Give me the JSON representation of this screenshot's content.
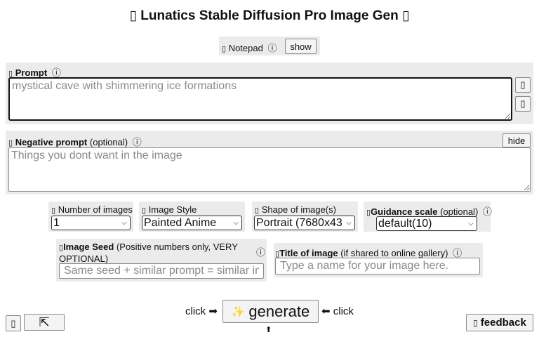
{
  "header": {
    "title": "Lunatics Stable Diffusion Pro Image Gen",
    "title_icon_left": "▯",
    "title_icon_right": "▯"
  },
  "notepad": {
    "label": "Notepad",
    "button": "show"
  },
  "prompt": {
    "label": "Prompt",
    "placeholder": "mystical cave with shimmering ice formations",
    "side_button_1_icon": "▯",
    "side_button_2_icon": "▯"
  },
  "negative_prompt": {
    "label": "Negative prompt",
    "optional": "(optional)",
    "placeholder": "Things you dont want in the image",
    "hide_button": "hide"
  },
  "options": {
    "num_images": {
      "label": "Number of images",
      "value": "1"
    },
    "style": {
      "label": "Image Style",
      "value": "Painted Anime"
    },
    "shape": {
      "label": "Shape of image(s)",
      "value": "Portrait (7680x43"
    },
    "guidance": {
      "label": "Guidance scale",
      "optional": "(optional)",
      "value": "default(10)"
    }
  },
  "seed": {
    "label": "Image Seed",
    "note": "(Positive numbers only, VERY OPTIONAL)",
    "placeholder": "Same seed + similar prompt = similar im"
  },
  "image_title": {
    "label": "Title of image",
    "note": "(if shared to online gallery)",
    "placeholder": "Type a name for your image here."
  },
  "generate": {
    "click_left": "click",
    "arrow_right": "➡",
    "label": "generate",
    "icon": "✨",
    "arrow_left": "⬅",
    "click_right": "click",
    "arrow_up": "⬆"
  },
  "footer": {
    "left_button_icon": "▯",
    "expand_button_icon": "⇱",
    "feedback_icon": "▯",
    "feedback_label": "feedback"
  },
  "icons": {
    "info": "ⓘ",
    "small_box": "▯"
  }
}
